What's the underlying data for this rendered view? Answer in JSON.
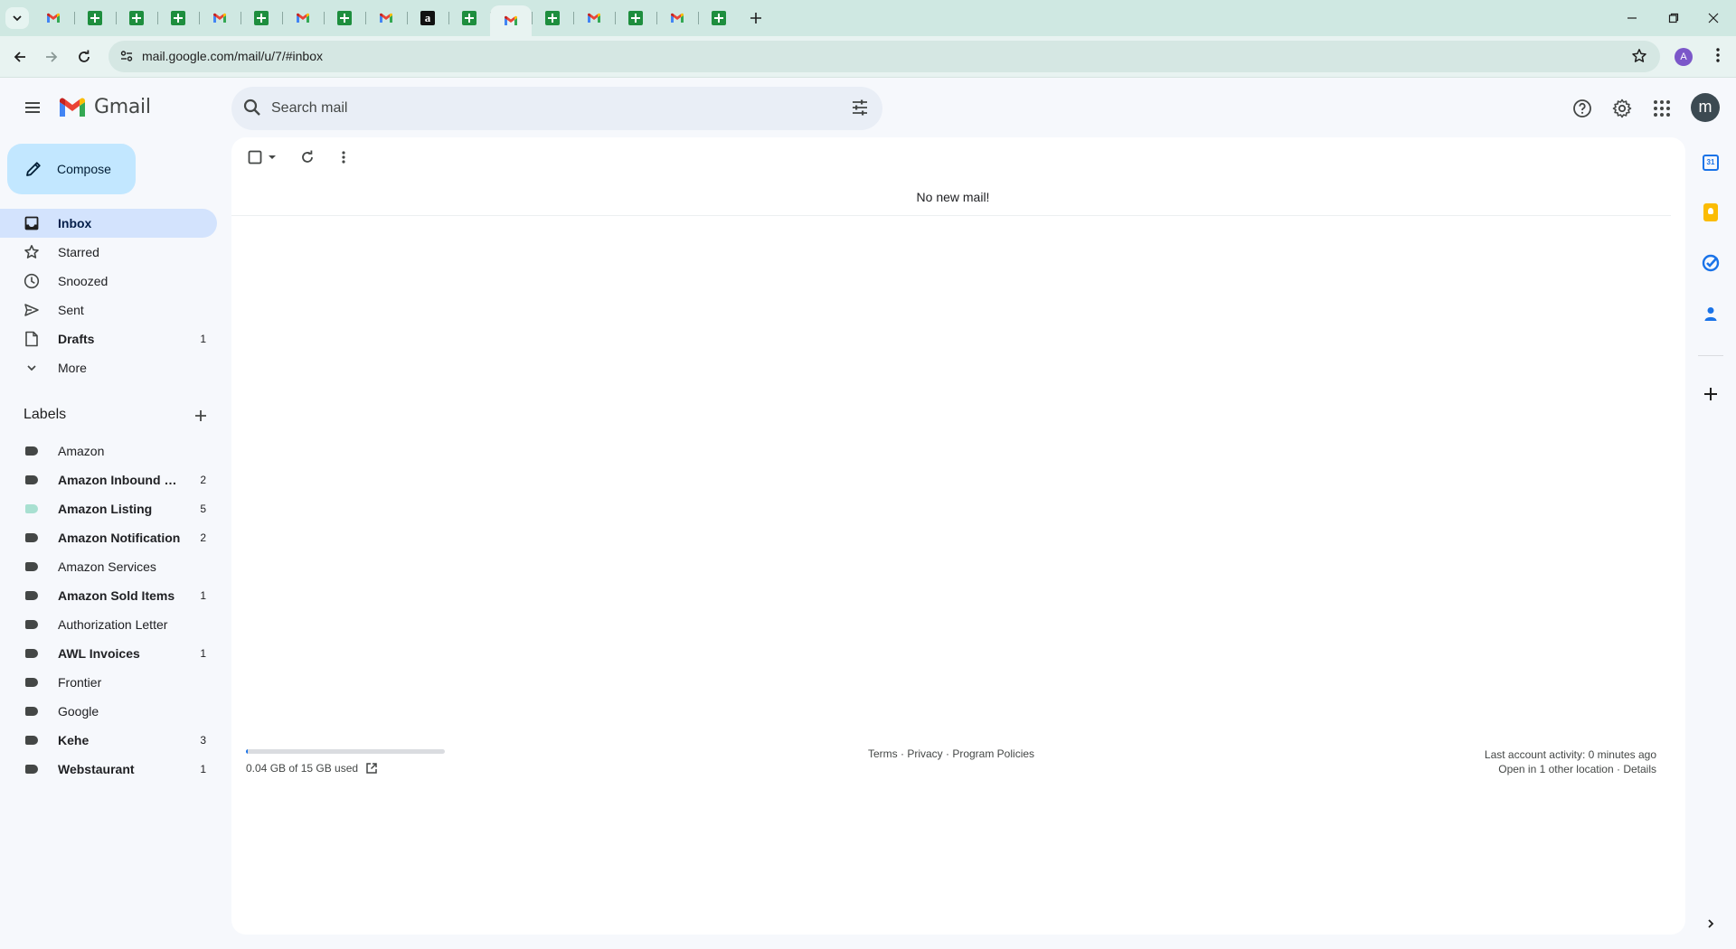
{
  "browser": {
    "tabs": [
      {
        "type": "gmail"
      },
      {
        "type": "sheets"
      },
      {
        "type": "sheets"
      },
      {
        "type": "sheets"
      },
      {
        "type": "gmail"
      },
      {
        "type": "sheets"
      },
      {
        "type": "gmail"
      },
      {
        "type": "sheets"
      },
      {
        "type": "gmail"
      },
      {
        "type": "amazon"
      },
      {
        "type": "sheets"
      },
      {
        "type": "gmail",
        "active": true
      },
      {
        "type": "sheets"
      },
      {
        "type": "gmail"
      },
      {
        "type": "sheets"
      },
      {
        "type": "gmail"
      },
      {
        "type": "sheets"
      }
    ],
    "amazon_glyph": "a",
    "url": "mail.google.com/mail/u/7/#inbox",
    "profile_initial": "A"
  },
  "gmail": {
    "logo_text": "Gmail",
    "search_placeholder": "Search mail",
    "avatar_initial": "m",
    "compose_label": "Compose",
    "nav": [
      {
        "label": "Inbox",
        "count": "",
        "icon": "inbox-icon",
        "active": true,
        "bold": true
      },
      {
        "label": "Starred",
        "count": "",
        "icon": "star-icon",
        "active": false,
        "bold": false
      },
      {
        "label": "Snoozed",
        "count": "",
        "icon": "clock-icon",
        "active": false,
        "bold": false
      },
      {
        "label": "Sent",
        "count": "",
        "icon": "send-icon",
        "active": false,
        "bold": false
      },
      {
        "label": "Drafts",
        "count": "1",
        "icon": "draft-icon",
        "active": false,
        "bold": true
      },
      {
        "label": "More",
        "count": "",
        "icon": "chevron-down-icon",
        "active": false,
        "bold": false
      }
    ],
    "labels_heading": "Labels",
    "labels": [
      {
        "label": "Amazon",
        "count": "",
        "bold": false,
        "color": "#444746"
      },
      {
        "label": "Amazon Inbound Shipments",
        "count": "2",
        "bold": true,
        "color": "#444746"
      },
      {
        "label": "Amazon Listing",
        "count": "5",
        "bold": true,
        "color": "#a8e0d1"
      },
      {
        "label": "Amazon Notification",
        "count": "2",
        "bold": true,
        "color": "#444746"
      },
      {
        "label": "Amazon Services",
        "count": "",
        "bold": false,
        "color": "#444746"
      },
      {
        "label": "Amazon Sold Items",
        "count": "1",
        "bold": true,
        "color": "#444746"
      },
      {
        "label": "Authorization Letter",
        "count": "",
        "bold": false,
        "color": "#444746"
      },
      {
        "label": "AWL Invoices",
        "count": "1",
        "bold": true,
        "color": "#444746"
      },
      {
        "label": "Frontier",
        "count": "",
        "bold": false,
        "color": "#444746"
      },
      {
        "label": "Google",
        "count": "",
        "bold": false,
        "color": "#444746"
      },
      {
        "label": "Kehe",
        "count": "3",
        "bold": true,
        "color": "#444746"
      },
      {
        "label": "Webstaurant",
        "count": "1",
        "bold": true,
        "color": "#444746"
      }
    ],
    "empty_message": "No new mail!",
    "storage": {
      "text": "0.04 GB of 15 GB used",
      "used_fraction": 0.0027
    },
    "footer_links": "Terms · Privacy · Program Policies",
    "last_activity": "Last account activity: 0 minutes ago",
    "other_location": "Open in 1 other location · Details"
  },
  "colors": {
    "accent": "#0b57d0",
    "compose_bg": "#c2e7ff",
    "active_nav": "#d3e3fd",
    "gmail_red": "#ea4335"
  }
}
